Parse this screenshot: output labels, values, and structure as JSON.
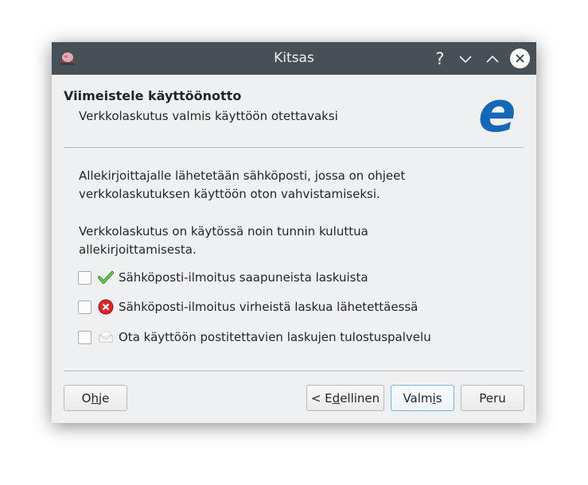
{
  "window": {
    "title": "Kitsas",
    "controls": {
      "help": "?",
      "minimize_icon": "chevron-down-icon",
      "maximize_icon": "chevron-up-icon",
      "close_icon": "close-icon"
    }
  },
  "header": {
    "title": "Viimeistele käyttöönotto",
    "subtitle": "Verkkolaskutus valmis käyttöön otettavaksi",
    "logo_letter": "e",
    "logo_color": "#1568b5"
  },
  "body": {
    "paragraph1": "Allekirjoittajalle lähetetään sähköposti, jossa on ohjeet\nverkkolaskutuksen käyttöön oton vahvistamiseksi.",
    "paragraph2": "Verkkolaskutus on käytössä noin tunnin kuluttua\nallekirjoittamisesta."
  },
  "options": [
    {
      "label": "Sähköposti-ilmoitus saapuneista laskuista",
      "checked": false,
      "icon": "check-icon"
    },
    {
      "label": "Sähköposti-ilmoitus virheistä laskua lähetettäessä",
      "checked": false,
      "icon": "error-icon"
    },
    {
      "label": "Ota käyttöön postitettavien laskujen tulostuspalvelu",
      "checked": false,
      "icon": "envelope-icon"
    }
  ],
  "buttons": {
    "help": {
      "pre": "O",
      "mnemonic": "h",
      "post": "je"
    },
    "back": {
      "pre": "< E",
      "mnemonic": "d",
      "post": "ellinen"
    },
    "finish": {
      "pre": "Valm",
      "mnemonic": "i",
      "post": "s"
    },
    "cancel": {
      "label": "Peru"
    }
  },
  "colors": {
    "titlebar": "#475057",
    "background": "#eff0f1",
    "check": "#3fae2a",
    "error": "#d8262b",
    "focus_border": "#76b6dd"
  }
}
